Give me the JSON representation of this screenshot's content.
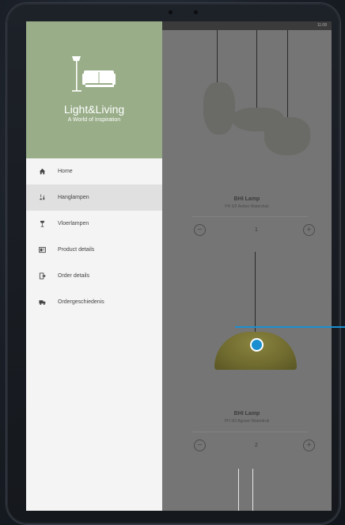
{
  "drawer": {
    "brand": "Light&Living",
    "tagline": "A World of Inspiration",
    "items": [
      {
        "label": "Home",
        "icon": "home-icon"
      },
      {
        "label": "Hanglampen",
        "icon": "pendant-lamp-icon",
        "active": true
      },
      {
        "label": "Vloerlampen",
        "icon": "floor-lamp-icon"
      },
      {
        "label": "Product details",
        "icon": "product-details-icon"
      },
      {
        "label": "Order details",
        "icon": "order-details-icon"
      },
      {
        "label": "Ordergeschiedenis",
        "icon": "truck-icon"
      }
    ]
  },
  "products": [
    {
      "name": "BHI Lamp",
      "subtitle": "PH 3/2 Amber Waterdruk",
      "quantity": "1"
    },
    {
      "name": "BHI Lamp",
      "subtitle": "PH 3/2 Agrave Waterdruk",
      "quantity": "2"
    }
  ],
  "status": {
    "time": "11:08"
  },
  "colors": {
    "header": "#98ad88",
    "accent": "#1b8fd0",
    "drawer_bg": "#f4f4f4"
  }
}
